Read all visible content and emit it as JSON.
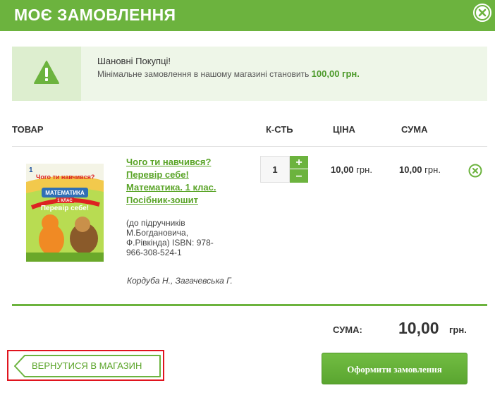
{
  "modal": {
    "title": "МОЄ ЗАМОВЛЕННЯ"
  },
  "notice": {
    "title": "Шановні Покупці!",
    "text": "Мінімальне замовлення в нашому магазині становить ",
    "amount": "100,00 грн."
  },
  "table": {
    "headers": {
      "product": "ТОВАР",
      "quantity": "К-СТЬ",
      "price": "ЦІНА",
      "sum": "СУМА"
    }
  },
  "items": [
    {
      "title_lines": [
        "Чого ти навчився?",
        "Перевір себе!",
        "Математика. 1 клас.",
        "Посібник-зошит"
      ],
      "desc_lines": [
        "(до підручників",
        "М.Богдановича,",
        "Ф.Рівкінда) ISBN: 978-",
        "966-308-524-1"
      ],
      "author": "Кордуба Н., Загачевська Г.",
      "cover_text": {
        "top": "Чого ти навчився?",
        "subject": "МАТЕМАТИКА",
        "grade": "1 КЛАС",
        "check": "Перевір себе!"
      },
      "quantity": "1",
      "price": "10,00",
      "sum": "10,00",
      "currency": "грн."
    }
  ],
  "total": {
    "label": "СУМА:",
    "value": "10,00",
    "currency": "грн."
  },
  "buttons": {
    "back": "ВЕРНУТИСЯ В МАГАЗИН",
    "checkout": "Оформити замовлення",
    "plus": "+",
    "minus": "–"
  },
  "colors": {
    "accent": "#6cb33e",
    "highlight_border": "#e0141e"
  },
  "icons": {
    "close": "close-circle-icon",
    "warning": "warning-triangle-icon",
    "remove": "remove-circle-icon",
    "back": "arrow-left-tag-icon"
  }
}
